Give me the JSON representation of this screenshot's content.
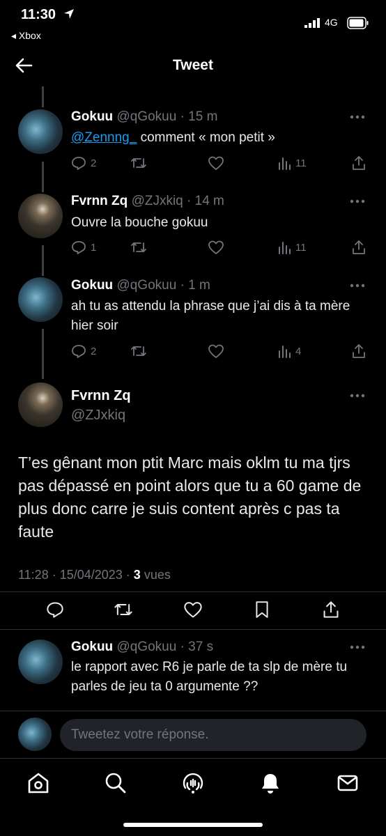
{
  "status_bar": {
    "time": "11:30",
    "back_app": "◂ Xbox",
    "network": "4G"
  },
  "header": {
    "title": "Tweet"
  },
  "replies_above": [
    {
      "name": "Gokuu",
      "handle": "@qGokuu",
      "time": "· 15 m",
      "mention": "@Zennng_",
      "text": " comment « mon petit »",
      "replies": "2",
      "views": "11"
    },
    {
      "name": "Fvrnn Zq",
      "handle": "@ZJxkiq",
      "time": "· 14 m",
      "text": "Ouvre la bouche gokuu",
      "replies": "1",
      "views": "11"
    },
    {
      "name": "Gokuu",
      "handle": "@qGokuu",
      "time": "· 1 m",
      "text": "ah tu as attendu la phrase que j’ai dis à ta mère hier soir",
      "replies": "2",
      "views": "4"
    }
  ],
  "main_tweet": {
    "name": "Fvrnn Zq",
    "handle": "@ZJxkiq",
    "text": "T’es gênant mon ptit Marc mais oklm tu ma tjrs pas dépassé en point alors que tu a 60 game de plus donc carre je suis content après c pas ta faute",
    "datetime": "11:28 · 15/04/2023 · ",
    "views_count": "3",
    "views_label": " vues"
  },
  "reply_below": {
    "name": "Gokuu",
    "handle": "@qGokuu",
    "time": "· 37 s",
    "text": "le rapport avec R6 je parle de ta slp de mère tu parles de jeu ta 0 argumente ??"
  },
  "reply_bar": {
    "placeholder": "Tweetez votre réponse."
  },
  "icons": [
    "back-arrow-icon",
    "more-icon",
    "reply-icon",
    "retweet-icon",
    "like-icon",
    "views-icon",
    "share-icon",
    "bookmark-icon",
    "home-icon",
    "search-icon",
    "spaces-icon",
    "notifications-icon",
    "messages-icon"
  ],
  "colors": {
    "background": "#000000",
    "text": "#e7e9ea",
    "secondary": "#71767b",
    "mention": "#1d9bf0",
    "divider": "#2f3336"
  }
}
